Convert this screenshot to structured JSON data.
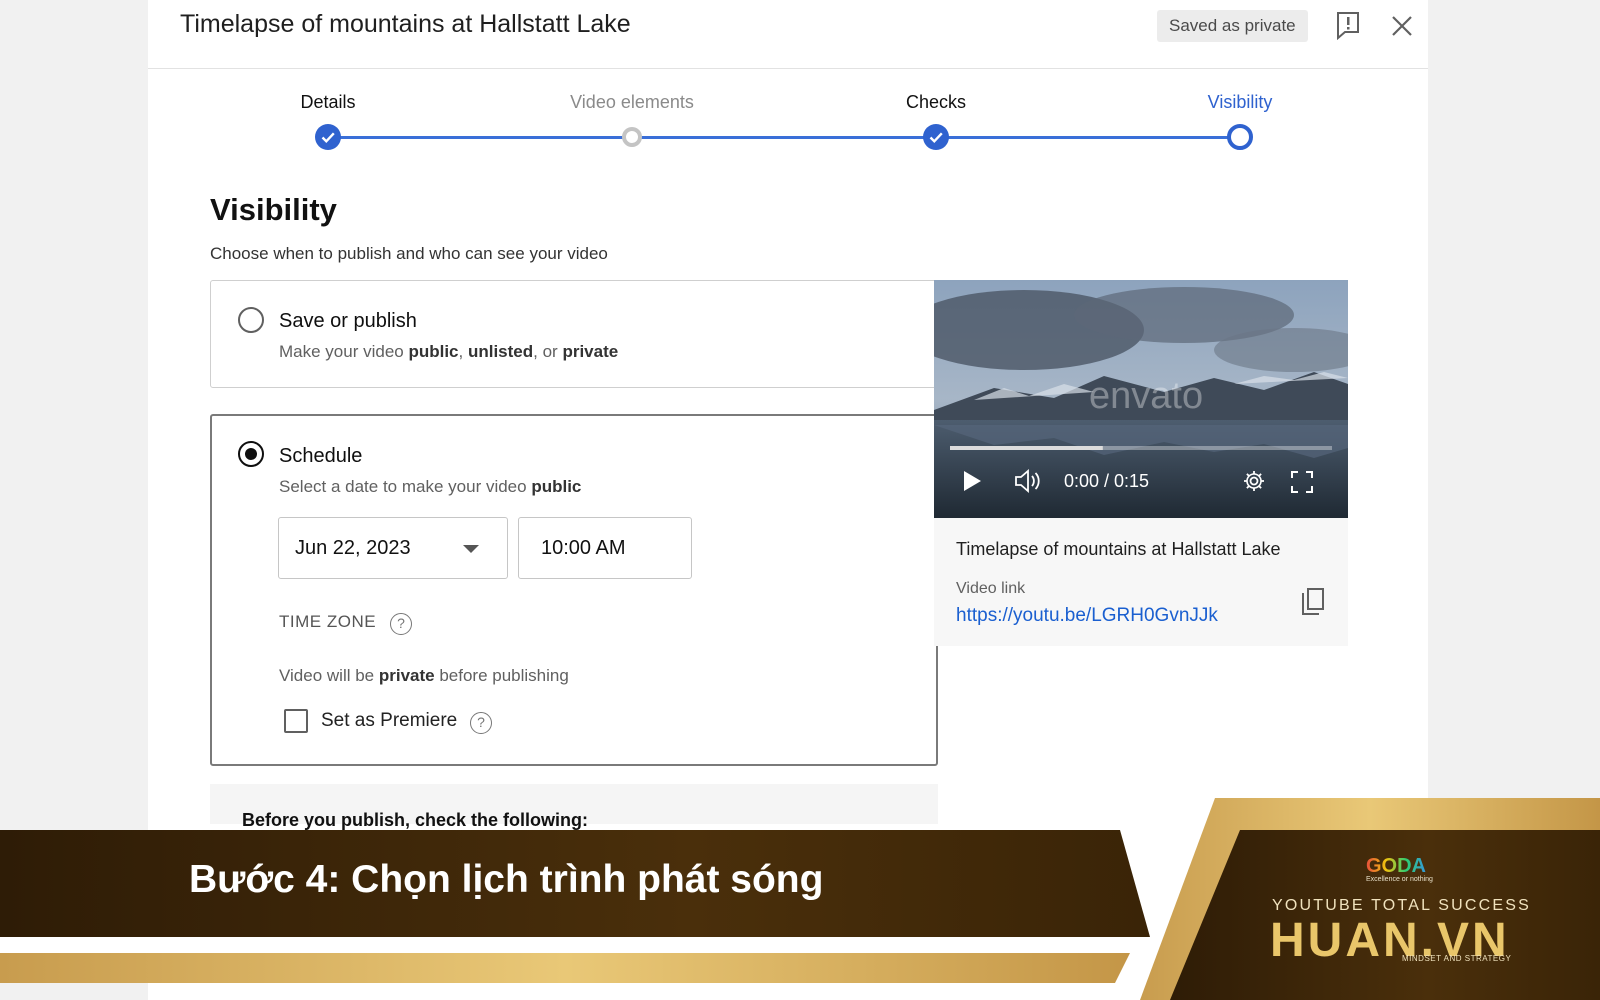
{
  "header": {
    "title": "Timelapse of mountains at Hallstatt Lake",
    "saved_badge": "Saved as private"
  },
  "stepper": {
    "steps": [
      {
        "label": "Details",
        "state": "done"
      },
      {
        "label": "Video elements",
        "state": "skipped"
      },
      {
        "label": "Checks",
        "state": "done"
      },
      {
        "label": "Visibility",
        "state": "current"
      }
    ]
  },
  "visibility": {
    "title": "Visibility",
    "subtitle": "Choose when to publish and who can see your video",
    "save_option": {
      "title": "Save or publish",
      "desc_prefix": "Make your video ",
      "desc_public": "public",
      "desc_sep1": ", ",
      "desc_unlisted": "unlisted",
      "desc_sep2": ", or ",
      "desc_private": "private",
      "selected": false
    },
    "schedule_option": {
      "title": "Schedule",
      "desc_prefix": "Select a date to make your video ",
      "desc_public": "public",
      "selected": true,
      "date_value": "Jun 22, 2023",
      "time_value": "10:00 AM",
      "timezone_label": "TIME ZONE",
      "private_note_prefix": "Video will be ",
      "private_note_bold": "private",
      "private_note_suffix": " before publishing",
      "premiere_label": "Set as Premiere",
      "premiere_checked": false
    },
    "checklist_title": "Before you publish, check the following:"
  },
  "video": {
    "time": "0:00 / 0:15",
    "watermark": "envato",
    "title": "Timelapse of mountains at Hallstatt Lake",
    "link_label": "Video link",
    "link": "https://youtu.be/LGRH0GvnJJk",
    "progress": 0.4
  },
  "banner": {
    "caption": "Bước 4: Chọn lịch trình phát sóng",
    "logo_text": "GODA",
    "logo_tagline": "Excellence or nothing",
    "brand_top": "YOUTUBE TOTAL SUCCESS",
    "brand_main": "HUAN.VN",
    "brand_sub": "MINDSET AND STRATEGY"
  },
  "colors": {
    "accent_blue": "#3a6fd8",
    "link_blue": "#1a5fd0",
    "banner_dark": "#3c2608",
    "banner_gold": "#d8b363"
  }
}
